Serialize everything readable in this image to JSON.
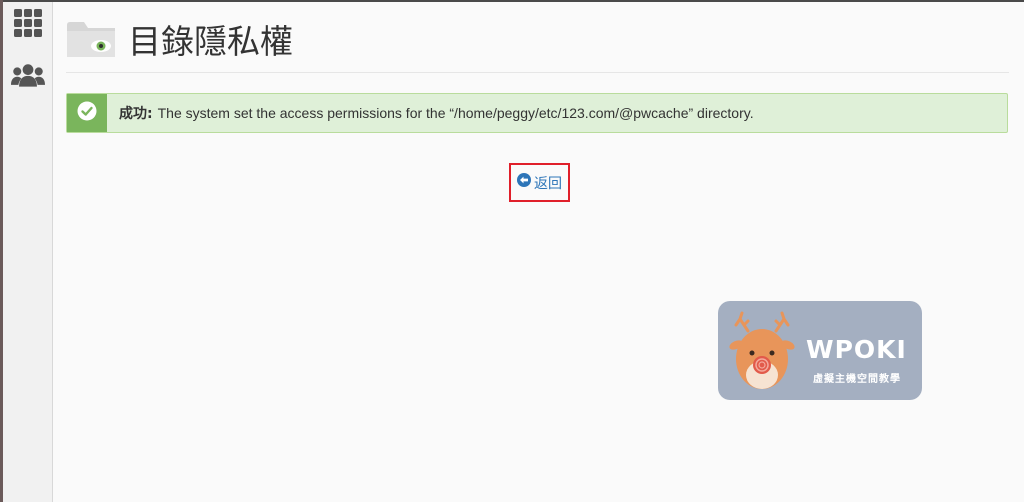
{
  "sidebar": {
    "items": [
      {
        "name": "grid-apps-icon"
      },
      {
        "name": "users-icon"
      }
    ]
  },
  "header": {
    "title": "目錄隱私權",
    "icon": "folder-eye-icon"
  },
  "alert": {
    "prefix": "成功:",
    "message": "The system set the access permissions for the “/home/peggy/etc/123.com/@pwcache” directory.",
    "icon": "check-circle-icon",
    "color": "#7ab55c"
  },
  "back": {
    "label": "返回",
    "icon": "arrow-circle-left-icon"
  },
  "watermark": {
    "brand": "WPOKI",
    "subtitle": "虛擬主機空間教學"
  },
  "colors": {
    "accent": "#2d75b8",
    "success_bg": "#dff0d8",
    "highlight": "#e01f2a"
  }
}
